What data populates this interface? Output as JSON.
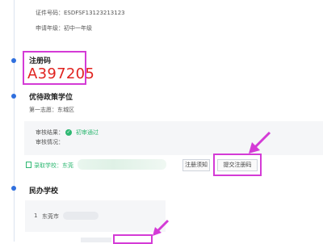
{
  "certificate": {
    "id_text": "证件号码：ESDFSF13123213123",
    "grade_text": "申请年级：初中一年级"
  },
  "registration": {
    "heading": "注册码",
    "code": "A397205"
  },
  "policy_school": {
    "heading": "优待政策学位",
    "first_choice": "第一志愿：东城区",
    "review_result_label": "审核结果：",
    "review_result_value": "初审通过",
    "review_status_label": "审核情况："
  },
  "admitted": {
    "label": "录取学校：东莞",
    "notice_button": "注册须知",
    "submit_button": "提交注册码"
  },
  "private_school": {
    "heading": "民办学校",
    "item_index": "1",
    "item_name": "东莞市"
  },
  "colors": {
    "accent": "#2f6fde",
    "highlight": "#d43bd6",
    "code_red": "#e0231f",
    "success_green": "#2eb872"
  }
}
